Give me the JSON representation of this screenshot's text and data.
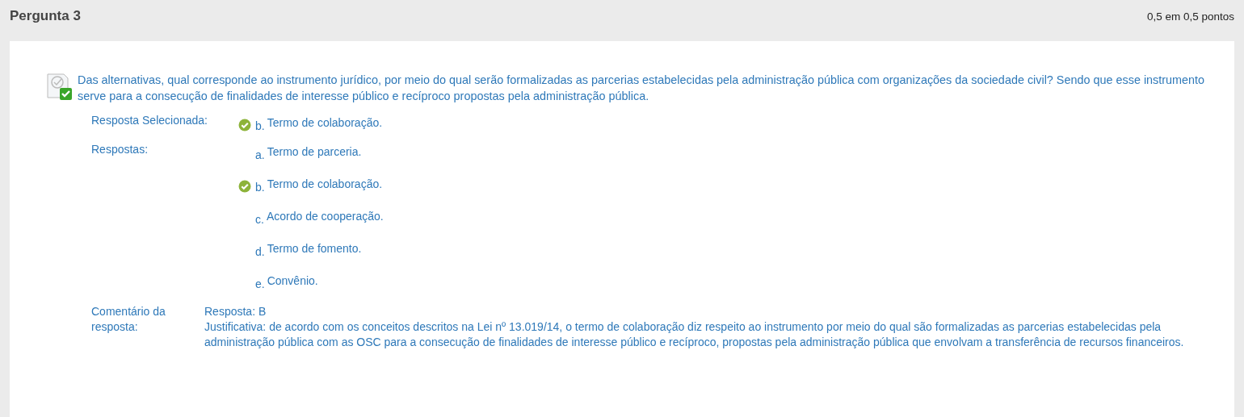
{
  "header": {
    "title": "Pergunta 3",
    "score": "0,5 em 0,5 pontos"
  },
  "question": {
    "correct": true,
    "text": "Das alternativas, qual corresponde ao instrumento jurídico, por meio do qual serão formalizadas as parcerias estabelecidas pela administração pública com organizações da sociedade civil? Sendo que esse instrumento serve para a consecução de finalidades de interesse público e recíproco propostas pela administração pública."
  },
  "selected_answer": {
    "label": "Resposta Selecionada:",
    "letter": "b.",
    "text": "Termo de colaboração.",
    "correct": true
  },
  "answers": {
    "label": "Respostas:",
    "options": [
      {
        "letter": "a.",
        "text": "Termo de parceria.",
        "correct": false
      },
      {
        "letter": "b.",
        "text": "Termo de colaboração.",
        "correct": true
      },
      {
        "letter": "c.",
        "text": "Acordo de cooperação.",
        "correct": false
      },
      {
        "letter": "d.",
        "text": "Termo de fomento.",
        "correct": false
      },
      {
        "letter": "e.",
        "text": "Convênio.",
        "correct": false
      }
    ]
  },
  "comment": {
    "label": "Comentário da resposta:",
    "lines": [
      "Resposta: B",
      "Justificativa: de acordo com os conceitos descritos na Lei nº 13.019/14, o termo de colaboração diz respeito ao instrumento por meio do qual são formalizadas as parcerias estabelecidas pela administração pública com as OSC para a consecução de finalidades de interesse público e recíproco, propostas pela administração pública que envolvam a transferência de recursos financeiros."
    ]
  }
}
